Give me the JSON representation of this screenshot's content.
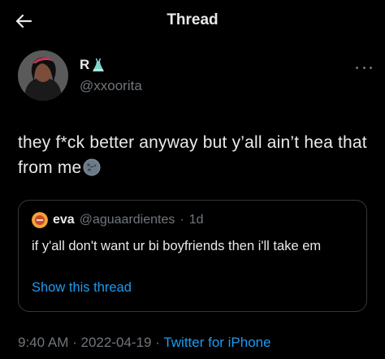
{
  "header": {
    "title": "Thread",
    "back_icon": "arrow-left-icon"
  },
  "tweet": {
    "author": {
      "display_name": "R",
      "badge_icon": "dress-emoji-icon",
      "handle": "@xxoorita"
    },
    "more_icon": "more-dots-icon",
    "text": "they f*ck better anyway but y’all ain’t hea that from me",
    "emoji": "new-moon-face-emoji-icon",
    "quote": {
      "display_name": "eva",
      "handle": "@aguaardientes",
      "separator": "·",
      "age": "1d",
      "text": "if y'all don't want ur bi boyfriends then i'll take em",
      "link": "Show this thread"
    },
    "meta": {
      "time": "9:40 AM",
      "sep1": "·",
      "date": "2022-04-19",
      "sep2": "·",
      "source": "Twitter for iPhone"
    }
  },
  "colors": {
    "background": "#000000",
    "text": "#e7e9ea",
    "secondary": "#71767b",
    "accent": "#1d9bf0",
    "border": "#333639"
  }
}
